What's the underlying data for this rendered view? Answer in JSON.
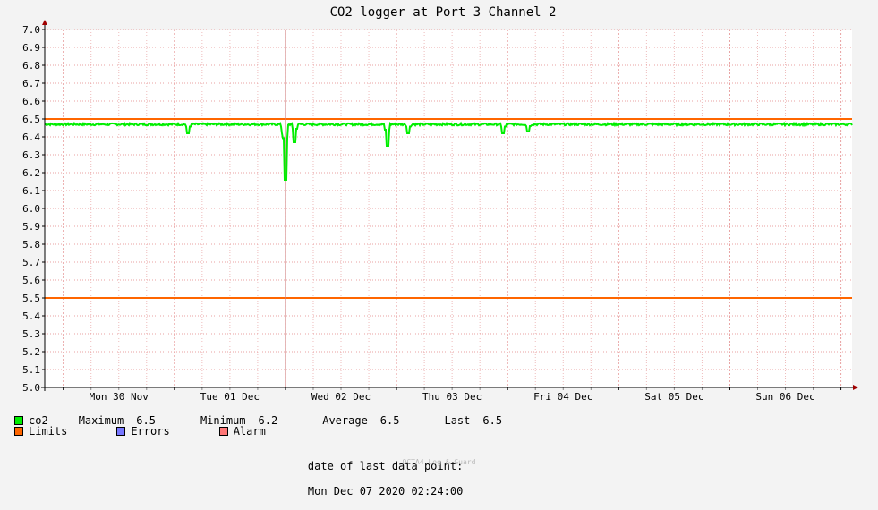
{
  "chart_data": {
    "type": "line",
    "title": "CO2 logger at Port 3 Channel 2",
    "xlabel": "",
    "ylabel": "",
    "ylim": [
      5.0,
      7.0
    ],
    "y_ticks": [
      "7.0",
      "6.9",
      "6.8",
      "6.7",
      "6.6",
      "6.5",
      "6.4",
      "6.3",
      "6.2",
      "6.1",
      "6.0",
      "5.9",
      "5.8",
      "5.7",
      "5.6",
      "5.5",
      "5.4",
      "5.3",
      "5.2",
      "5.1",
      "5.0"
    ],
    "x_range": [
      "2020-11-29 20:00",
      "2020-12-07 02:24"
    ],
    "x_ticks": [
      "Mon 30 Nov",
      "Tue 01 Dec",
      "Wed 02 Dec",
      "Thu 03 Dec",
      "Fri 04 Dec",
      "Sat 05 Dec",
      "Sun 06 Dec"
    ],
    "grid": true,
    "colors": {
      "co2": "#00ee00",
      "limits": "#ff6600",
      "errors": "#7777ff",
      "alarm": "#ff7777",
      "grid": "#e8a0a0"
    },
    "limits": [
      6.5,
      5.5
    ],
    "series": [
      {
        "name": "co2",
        "baseline": 6.47,
        "dips": [
          {
            "x": "2020-12-01 03:00",
            "y": 6.42
          },
          {
            "x": "2020-12-01 23:30",
            "y": 6.42
          },
          {
            "x": "2020-12-02 00:00",
            "y": 6.16
          },
          {
            "x": "2020-12-02 02:00",
            "y": 6.37
          },
          {
            "x": "2020-12-02 22:00",
            "y": 6.35
          },
          {
            "x": "2020-12-03 02:30",
            "y": 6.42
          },
          {
            "x": "2020-12-03 23:00",
            "y": 6.42
          },
          {
            "x": "2020-12-04 04:30",
            "y": 6.43
          }
        ]
      }
    ],
    "marker_time": "2020-12-02 00:00"
  },
  "legend": {
    "co2_label": "co2",
    "maximum_label": "Maximum",
    "maximum_value": "6.5",
    "minimum_label": "Minimum",
    "minimum_value": "6.2",
    "average_label": "Average",
    "average_value": "6.5",
    "last_label": "Last",
    "last_value": "6.5",
    "limits_label": "Limits",
    "errors_label": "Errors",
    "alarm_label": "Alarm"
  },
  "footer": {
    "last_point_label": "date of last data point:",
    "last_point_value": "Mon Dec 07 2020 02:24:00",
    "credit": "OCTA4 Log & Guard"
  }
}
